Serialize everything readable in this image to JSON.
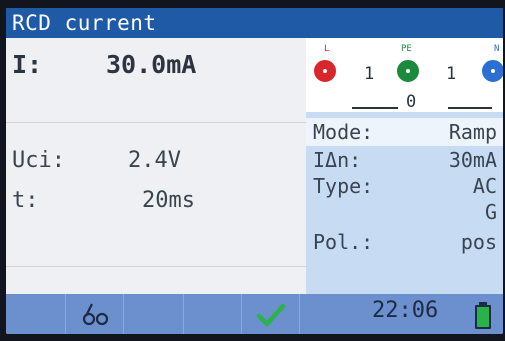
{
  "title": "RCD current",
  "main": {
    "i_label": "I:",
    "i_value": "30.0mA",
    "uci_label": "Uci:",
    "uci_value": "2.4V",
    "t_label": "t:",
    "t_value": "20ms"
  },
  "terminals": {
    "l_label": "L",
    "pe_label": "PE",
    "n_label": "N",
    "l_pe_value": "1",
    "pe_n_value": "1",
    "pe_bottom_value": "0"
  },
  "params": {
    "mode_label": "Mode:",
    "mode_value": "Ramp",
    "idn_label": "IΔn:",
    "idn_value": "30mA",
    "type_label": "Type:",
    "type_value": "AC",
    "type_value2": "G",
    "pol_label": "Pol.:",
    "pol_value": "pos"
  },
  "status": {
    "time": "22:06"
  },
  "colors": {
    "title_bar": "#1f5aa6",
    "right_pane": "#c7dcf3",
    "bottom_bar": "#6c8fce",
    "check_green": "#2bb24c",
    "battery_green": "#27b34a",
    "terminal_l": "#d9262b",
    "terminal_pe": "#1c8a3c",
    "terminal_n": "#2a6fd1"
  },
  "icons": [
    "probe-icon",
    "check-icon",
    "battery-icon"
  ]
}
